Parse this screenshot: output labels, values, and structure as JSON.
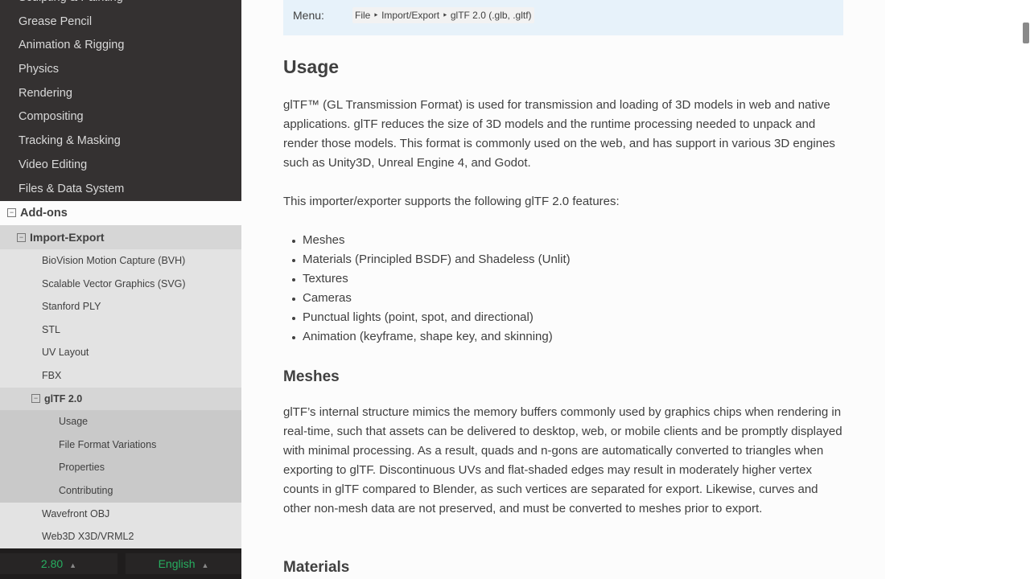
{
  "sidebar": {
    "dark_items": [
      "Sculpting & Painting",
      "Grease Pencil",
      "Animation & Rigging",
      "Physics",
      "Rendering",
      "Compositing",
      "Tracking & Masking",
      "Video Editing",
      "Files & Data System"
    ],
    "addons_label": "Add-ons",
    "import_export_label": "Import-Export",
    "import_export_items": [
      "BioVision Motion Capture (BVH)",
      "Scalable Vector Graphics (SVG)",
      "Stanford PLY",
      "STL",
      "UV Layout",
      "FBX"
    ],
    "gltf_label": "glTF 2.0",
    "gltf_items": [
      "Usage",
      "File Format Variations",
      "Properties",
      "Contributing"
    ],
    "after_items": [
      "Wavefront OBJ",
      "Web3D X3D/VRML2"
    ],
    "version": "2.80",
    "language": "English",
    "toggle_symbol": "⊟"
  },
  "content": {
    "menu_label": "Menu:",
    "menu_path": "File ‣ Import/Export ‣ glTF 2.0 (.glb, .gltf)",
    "usage_heading": "Usage",
    "usage_para": "glTF™ (GL Transmission Format) is used for transmission and loading of 3D models in web and native applications. glTF reduces the size of 3D models and the runtime processing needed to unpack and render those models. This format is commonly used on the web, and has support in various 3D engines such as Unity3D, Unreal Engine 4, and Godot.",
    "features_intro": "This importer/exporter supports the following glTF 2.0 features:",
    "features": [
      "Meshes",
      "Materials (Principled BSDF) and Shadeless (Unlit)",
      "Textures",
      "Cameras",
      "Punctual lights (point, spot, and directional)",
      "Animation (keyframe, shape key, and skinning)"
    ],
    "meshes_heading": "Meshes",
    "meshes_para": "glTF’s internal structure mimics the memory buffers commonly used by graphics chips when rendering in real-time, such that assets can be delivered to desktop, web, or mobile clients and be promptly displayed with minimal processing. As a result, quads and n-gons are automatically converted to triangles when exporting to glTF. Discontinuous UVs and flat-shaded edges may result in moderately higher vertex counts in glTF compared to Blender, as such vertices are separated for export. Likewise, curves and other non-mesh data are not preserved, and must be converted to meshes prior to export.",
    "materials_heading": "Materials"
  },
  "colors": {
    "sidebar_bg": "#343131",
    "accent_green": "#27ae60",
    "note_bg": "#e7f2fa"
  }
}
